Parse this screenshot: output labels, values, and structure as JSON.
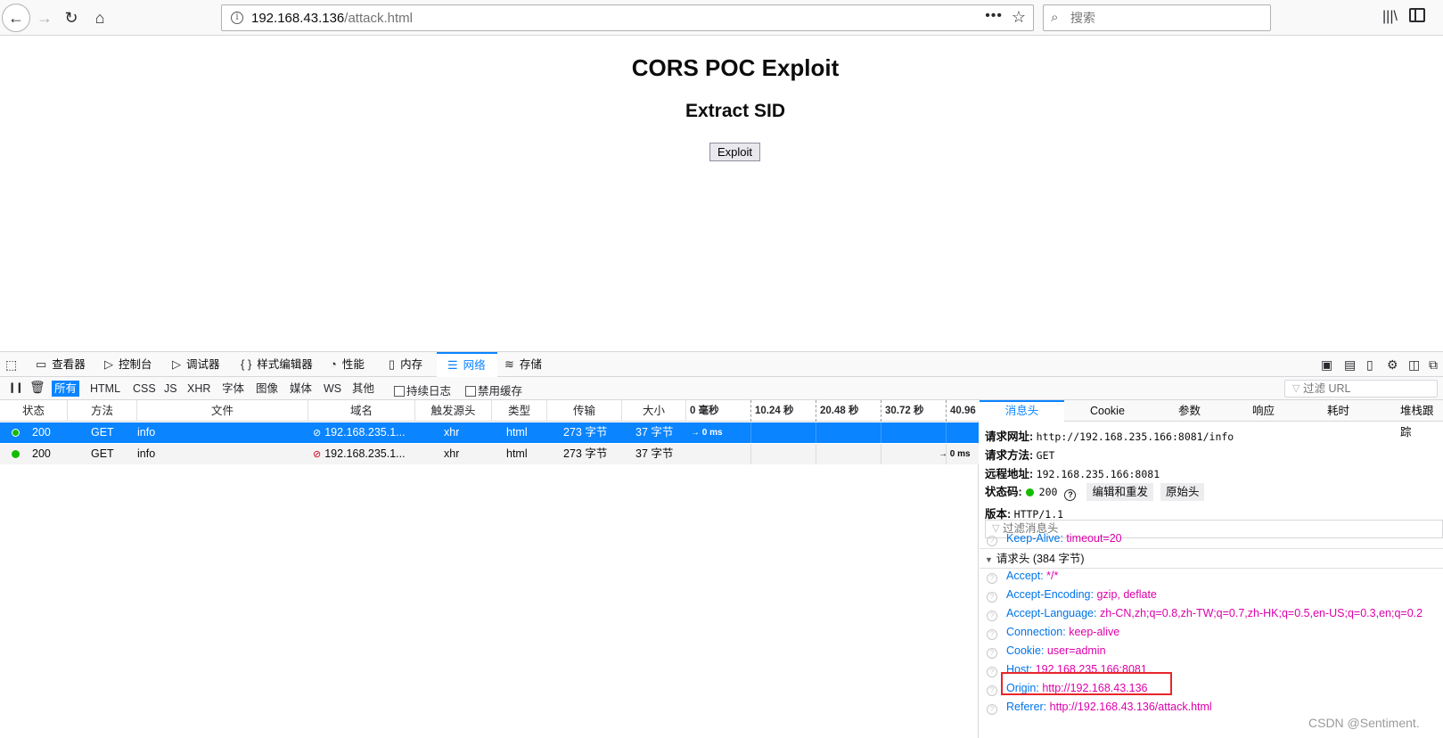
{
  "browser": {
    "url_host": "192.168.43.136",
    "url_path": "/attack.html",
    "search_placeholder": "搜索"
  },
  "page": {
    "title": "CORS POC Exploit",
    "subtitle": "Extract SID",
    "button": "Exploit"
  },
  "devtools": {
    "tabs": [
      "查看器",
      "控制台",
      "调试器",
      "样式编辑器",
      "性能",
      "内存",
      "网络",
      "存储"
    ],
    "filters": [
      "所有",
      "HTML",
      "CSS",
      "JS",
      "XHR",
      "字体",
      "图像",
      "媒体",
      "WS",
      "其他"
    ],
    "persist_log": "持续日志",
    "disable_cache": "禁用缓存",
    "filter_url_placeholder": "过滤 URL",
    "columns": [
      "状态",
      "方法",
      "文件",
      "域名",
      "触发源头",
      "类型",
      "传输",
      "大小"
    ],
    "timeline_ticks": [
      "0 毫秒",
      "10.24 秒",
      "20.48 秒",
      "30.72 秒",
      "40.96"
    ],
    "requests": [
      {
        "status": "200",
        "method": "GET",
        "file": "info",
        "domain": "192.168.235.1...",
        "cause": "xhr",
        "type": "html",
        "transferred": "273 字节",
        "size": "37 字节",
        "timing": "→ 0 ms"
      },
      {
        "status": "200",
        "method": "GET",
        "file": "info",
        "domain": "192.168.235.1...",
        "cause": "xhr",
        "type": "html",
        "transferred": "273 字节",
        "size": "37 字节",
        "timing": "→ 0 ms"
      }
    ]
  },
  "details": {
    "tabs": [
      "消息头",
      "Cookie",
      "参数",
      "响应",
      "耗时",
      "堆栈跟踪"
    ],
    "request_url_label": "请求网址:",
    "request_url": "http://192.168.235.166:8081/info",
    "request_method_label": "请求方法:",
    "request_method": "GET",
    "remote_addr_label": "远程地址:",
    "remote_addr": "192.168.235.166:8081",
    "status_label": "状态码:",
    "status": "200",
    "edit_resend": "编辑和重发",
    "raw_headers": "原始头",
    "version_label": "版本:",
    "version": "HTTP/1.1",
    "filter_headers_placeholder": "过滤消息头",
    "keep_alive": {
      "name": "Keep-Alive:",
      "value": "timeout=20"
    },
    "request_headers_section": "请求头 (384 字节)",
    "request_headers": [
      {
        "name": "Accept:",
        "value": "*/*"
      },
      {
        "name": "Accept-Encoding:",
        "value": "gzip, deflate"
      },
      {
        "name": "Accept-Language:",
        "value": "zh-CN,zh;q=0.8,zh-TW;q=0.7,zh-HK;q=0.5,en-US;q=0.3,en;q=0.2"
      },
      {
        "name": "Connection:",
        "value": "keep-alive"
      },
      {
        "name": "Cookie:",
        "value": "user=admin"
      },
      {
        "name": "Host:",
        "value": "192.168.235.166:8081"
      },
      {
        "name": "Origin:",
        "value": "http://192.168.43.136"
      },
      {
        "name": "Referer:",
        "value": "http://192.168.43.136/attack.html"
      }
    ]
  },
  "watermark": "CSDN @Sentiment."
}
